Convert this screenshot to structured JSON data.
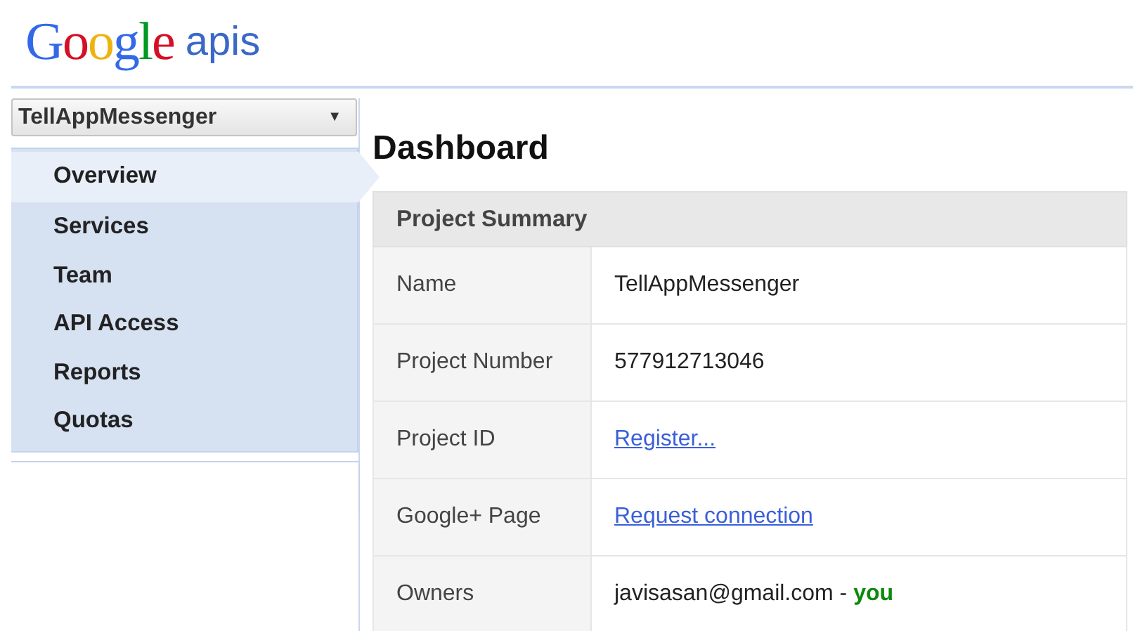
{
  "header": {
    "logo": "Google",
    "product": "apis"
  },
  "project_selector": {
    "value": "TellAppMessenger",
    "arrow": "▼"
  },
  "sidebar": {
    "items": [
      {
        "label": "Overview",
        "selected": true
      },
      {
        "label": "Services",
        "selected": false
      },
      {
        "label": "Team",
        "selected": false
      },
      {
        "label": "API Access",
        "selected": false
      },
      {
        "label": "Reports",
        "selected": false
      },
      {
        "label": "Quotas",
        "selected": false
      }
    ]
  },
  "main": {
    "title": "Dashboard",
    "summary": {
      "title": "Project Summary",
      "rows": [
        {
          "label": "Name",
          "value": "TellAppMessenger",
          "kind": "text"
        },
        {
          "label": "Project Number",
          "value": "577912713046",
          "kind": "text"
        },
        {
          "label": "Project ID",
          "value": "Register...",
          "kind": "link"
        },
        {
          "label": "Google+ Page",
          "value": "Request connection",
          "kind": "link"
        },
        {
          "label": "Owners",
          "value": "javisasan@gmail.com - **you**",
          "kind": "text"
        }
      ]
    }
  }
}
